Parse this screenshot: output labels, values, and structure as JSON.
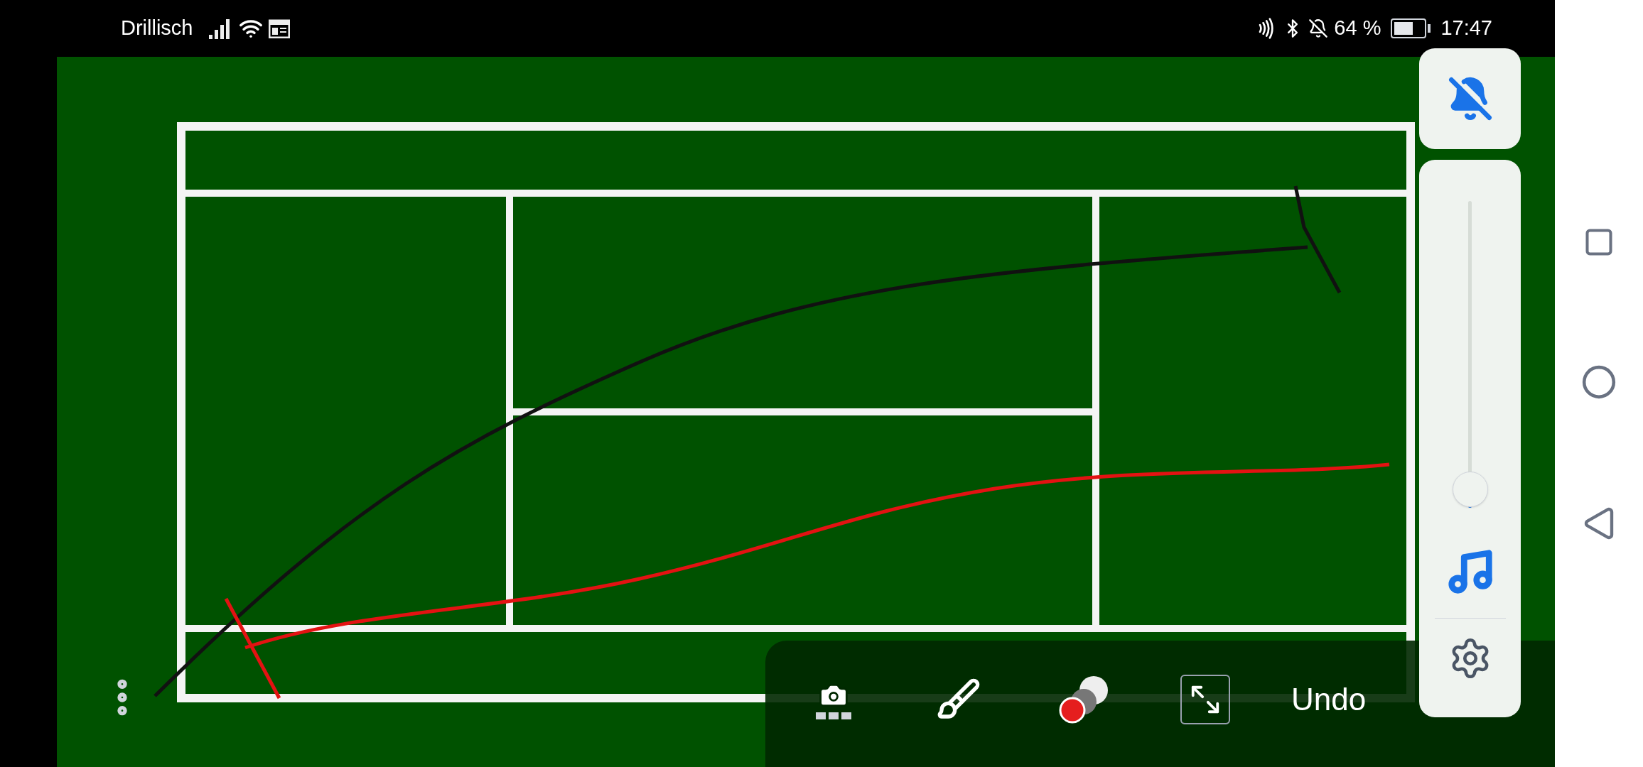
{
  "status_bar": {
    "carrier": "Drillisch",
    "battery": "64 %",
    "time": "17:47"
  },
  "volume_panel": {
    "muted": true,
    "level": 0.06
  },
  "toolbar": {
    "undo": "Undo"
  }
}
